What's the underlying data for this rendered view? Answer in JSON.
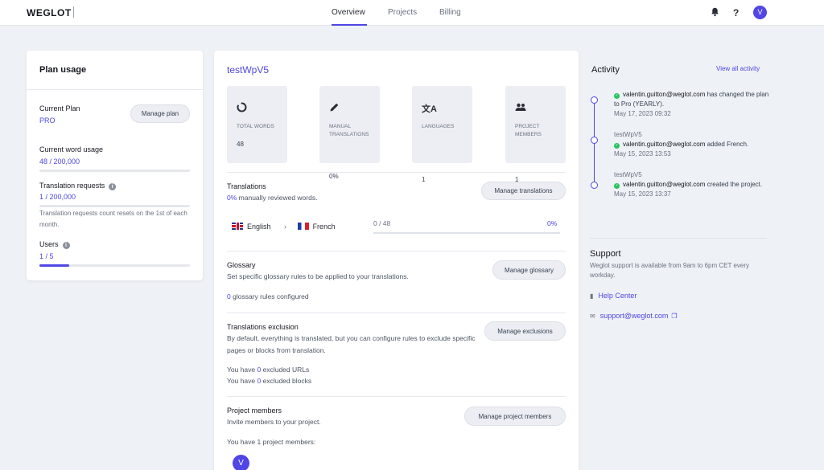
{
  "app": {
    "logo": "WEGLOT"
  },
  "nav": {
    "items": [
      "Overview",
      "Projects",
      "Billing"
    ],
    "active": "Overview"
  },
  "header": {
    "user_initial": "V"
  },
  "plan": {
    "title": "Plan usage",
    "current_plan_label": "Current Plan",
    "current_plan_value": "PRO",
    "manage_plan_button": "Manage plan",
    "word_usage_label": "Current word usage",
    "word_usage_value": "48 / 200,000",
    "word_usage_fraction": 0.00024,
    "translation_requests_label": "Translation requests",
    "translation_requests_value": "1 / 200,000",
    "translation_requests_note": "Translation requests count resets on the 1st of each month.",
    "users_label": "Users",
    "users_value": "1 / 5",
    "users_fraction": 0.2
  },
  "project": {
    "name": "testWpV5",
    "stats": [
      {
        "icon": "loader-icon",
        "label": "TOTAL WORDS",
        "value": "48"
      },
      {
        "icon": "pencil-icon",
        "label": "MANUAL TRANSLATIONS",
        "value": "0%"
      },
      {
        "icon": "translate-icon",
        "label": "LANGUAGES",
        "value": "1"
      },
      {
        "icon": "users-icon",
        "label": "PROJECT MEMBERS",
        "value": "1"
      }
    ],
    "translations": {
      "title": "Translations",
      "reviewed_pct": "0%",
      "reviewed_text": " manually reviewed words.",
      "button": "Manage translations",
      "source_lang": "English",
      "target_lang": "French",
      "progress_count": "0 / 48",
      "progress_pct": "0%"
    },
    "glossary": {
      "title": "Glossary",
      "desc": "Set specific glossary rules to be applied to your translations.",
      "count": "0",
      "count_text": " glossary rules configured",
      "button": "Manage glossary"
    },
    "exclusion": {
      "title": "Translations exclusion",
      "desc": "By default, everything is translated, but you can configure rules to exclude specific pages or blocks from translation.",
      "urls_prefix": "You have ",
      "urls_count": "0",
      "urls_suffix": " excluded URLs",
      "blocks_prefix": "You have ",
      "blocks_count": "0",
      "blocks_suffix": " excluded blocks",
      "button": "Manage exclusions"
    },
    "members": {
      "title": "Project members",
      "desc": "Invite members to your project.",
      "count_prefix": "You have ",
      "count": "1",
      "count_suffix": " project members:",
      "button": "Manage project members",
      "avatar_initial": "V"
    }
  },
  "activity": {
    "title": "Activity",
    "view_all": "View all activity",
    "items": [
      {
        "project": "",
        "user": "valentin.guitton@weglot.com",
        "text": " has changed the plan to Pro (YEARLY).",
        "date": "May 17, 2023 09:32"
      },
      {
        "project": "testWpV5",
        "user": "valentin.guitton@weglot.com",
        "text": " added French.",
        "date": "May 15, 2023 13:53"
      },
      {
        "project": "testWpV5",
        "user": "valentin.guitton@weglot.com",
        "text": " created the project.",
        "date": "May 15, 2023 13:37"
      }
    ]
  },
  "support": {
    "title": "Support",
    "text": "Weglot support is available from 9am to 6pm CET every workday.",
    "help_center": "Help Center",
    "email": "support@weglot.com"
  },
  "colors": {
    "accent": "#4f46e5",
    "success": "#22c55e",
    "background": "#eef1f5"
  }
}
